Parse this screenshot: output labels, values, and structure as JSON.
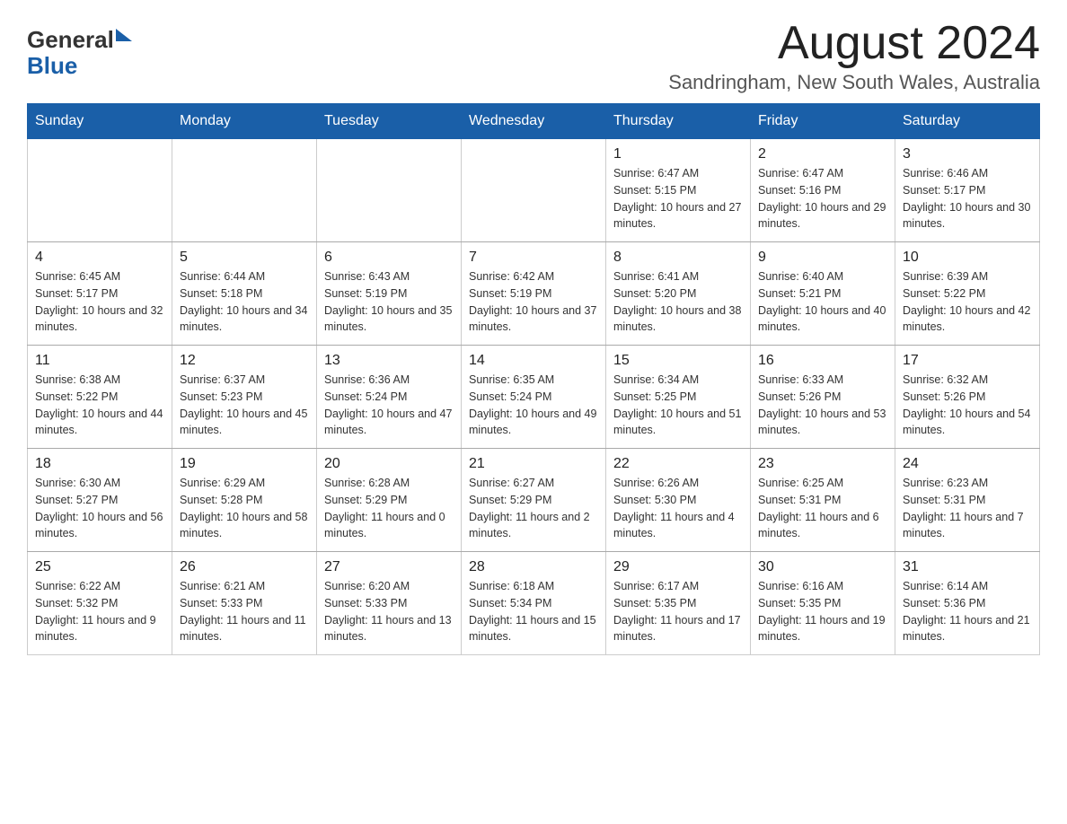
{
  "header": {
    "logo_general": "General",
    "logo_blue": "Blue",
    "month_title": "August 2024",
    "location": "Sandringham, New South Wales, Australia"
  },
  "weekdays": [
    "Sunday",
    "Monday",
    "Tuesday",
    "Wednesday",
    "Thursday",
    "Friday",
    "Saturday"
  ],
  "weeks": [
    [
      {
        "day": "",
        "info": ""
      },
      {
        "day": "",
        "info": ""
      },
      {
        "day": "",
        "info": ""
      },
      {
        "day": "",
        "info": ""
      },
      {
        "day": "1",
        "info": "Sunrise: 6:47 AM\nSunset: 5:15 PM\nDaylight: 10 hours and 27 minutes."
      },
      {
        "day": "2",
        "info": "Sunrise: 6:47 AM\nSunset: 5:16 PM\nDaylight: 10 hours and 29 minutes."
      },
      {
        "day": "3",
        "info": "Sunrise: 6:46 AM\nSunset: 5:17 PM\nDaylight: 10 hours and 30 minutes."
      }
    ],
    [
      {
        "day": "4",
        "info": "Sunrise: 6:45 AM\nSunset: 5:17 PM\nDaylight: 10 hours and 32 minutes."
      },
      {
        "day": "5",
        "info": "Sunrise: 6:44 AM\nSunset: 5:18 PM\nDaylight: 10 hours and 34 minutes."
      },
      {
        "day": "6",
        "info": "Sunrise: 6:43 AM\nSunset: 5:19 PM\nDaylight: 10 hours and 35 minutes."
      },
      {
        "day": "7",
        "info": "Sunrise: 6:42 AM\nSunset: 5:19 PM\nDaylight: 10 hours and 37 minutes."
      },
      {
        "day": "8",
        "info": "Sunrise: 6:41 AM\nSunset: 5:20 PM\nDaylight: 10 hours and 38 minutes."
      },
      {
        "day": "9",
        "info": "Sunrise: 6:40 AM\nSunset: 5:21 PM\nDaylight: 10 hours and 40 minutes."
      },
      {
        "day": "10",
        "info": "Sunrise: 6:39 AM\nSunset: 5:22 PM\nDaylight: 10 hours and 42 minutes."
      }
    ],
    [
      {
        "day": "11",
        "info": "Sunrise: 6:38 AM\nSunset: 5:22 PM\nDaylight: 10 hours and 44 minutes."
      },
      {
        "day": "12",
        "info": "Sunrise: 6:37 AM\nSunset: 5:23 PM\nDaylight: 10 hours and 45 minutes."
      },
      {
        "day": "13",
        "info": "Sunrise: 6:36 AM\nSunset: 5:24 PM\nDaylight: 10 hours and 47 minutes."
      },
      {
        "day": "14",
        "info": "Sunrise: 6:35 AM\nSunset: 5:24 PM\nDaylight: 10 hours and 49 minutes."
      },
      {
        "day": "15",
        "info": "Sunrise: 6:34 AM\nSunset: 5:25 PM\nDaylight: 10 hours and 51 minutes."
      },
      {
        "day": "16",
        "info": "Sunrise: 6:33 AM\nSunset: 5:26 PM\nDaylight: 10 hours and 53 minutes."
      },
      {
        "day": "17",
        "info": "Sunrise: 6:32 AM\nSunset: 5:26 PM\nDaylight: 10 hours and 54 minutes."
      }
    ],
    [
      {
        "day": "18",
        "info": "Sunrise: 6:30 AM\nSunset: 5:27 PM\nDaylight: 10 hours and 56 minutes."
      },
      {
        "day": "19",
        "info": "Sunrise: 6:29 AM\nSunset: 5:28 PM\nDaylight: 10 hours and 58 minutes."
      },
      {
        "day": "20",
        "info": "Sunrise: 6:28 AM\nSunset: 5:29 PM\nDaylight: 11 hours and 0 minutes."
      },
      {
        "day": "21",
        "info": "Sunrise: 6:27 AM\nSunset: 5:29 PM\nDaylight: 11 hours and 2 minutes."
      },
      {
        "day": "22",
        "info": "Sunrise: 6:26 AM\nSunset: 5:30 PM\nDaylight: 11 hours and 4 minutes."
      },
      {
        "day": "23",
        "info": "Sunrise: 6:25 AM\nSunset: 5:31 PM\nDaylight: 11 hours and 6 minutes."
      },
      {
        "day": "24",
        "info": "Sunrise: 6:23 AM\nSunset: 5:31 PM\nDaylight: 11 hours and 7 minutes."
      }
    ],
    [
      {
        "day": "25",
        "info": "Sunrise: 6:22 AM\nSunset: 5:32 PM\nDaylight: 11 hours and 9 minutes."
      },
      {
        "day": "26",
        "info": "Sunrise: 6:21 AM\nSunset: 5:33 PM\nDaylight: 11 hours and 11 minutes."
      },
      {
        "day": "27",
        "info": "Sunrise: 6:20 AM\nSunset: 5:33 PM\nDaylight: 11 hours and 13 minutes."
      },
      {
        "day": "28",
        "info": "Sunrise: 6:18 AM\nSunset: 5:34 PM\nDaylight: 11 hours and 15 minutes."
      },
      {
        "day": "29",
        "info": "Sunrise: 6:17 AM\nSunset: 5:35 PM\nDaylight: 11 hours and 17 minutes."
      },
      {
        "day": "30",
        "info": "Sunrise: 6:16 AM\nSunset: 5:35 PM\nDaylight: 11 hours and 19 minutes."
      },
      {
        "day": "31",
        "info": "Sunrise: 6:14 AM\nSunset: 5:36 PM\nDaylight: 11 hours and 21 minutes."
      }
    ]
  ]
}
